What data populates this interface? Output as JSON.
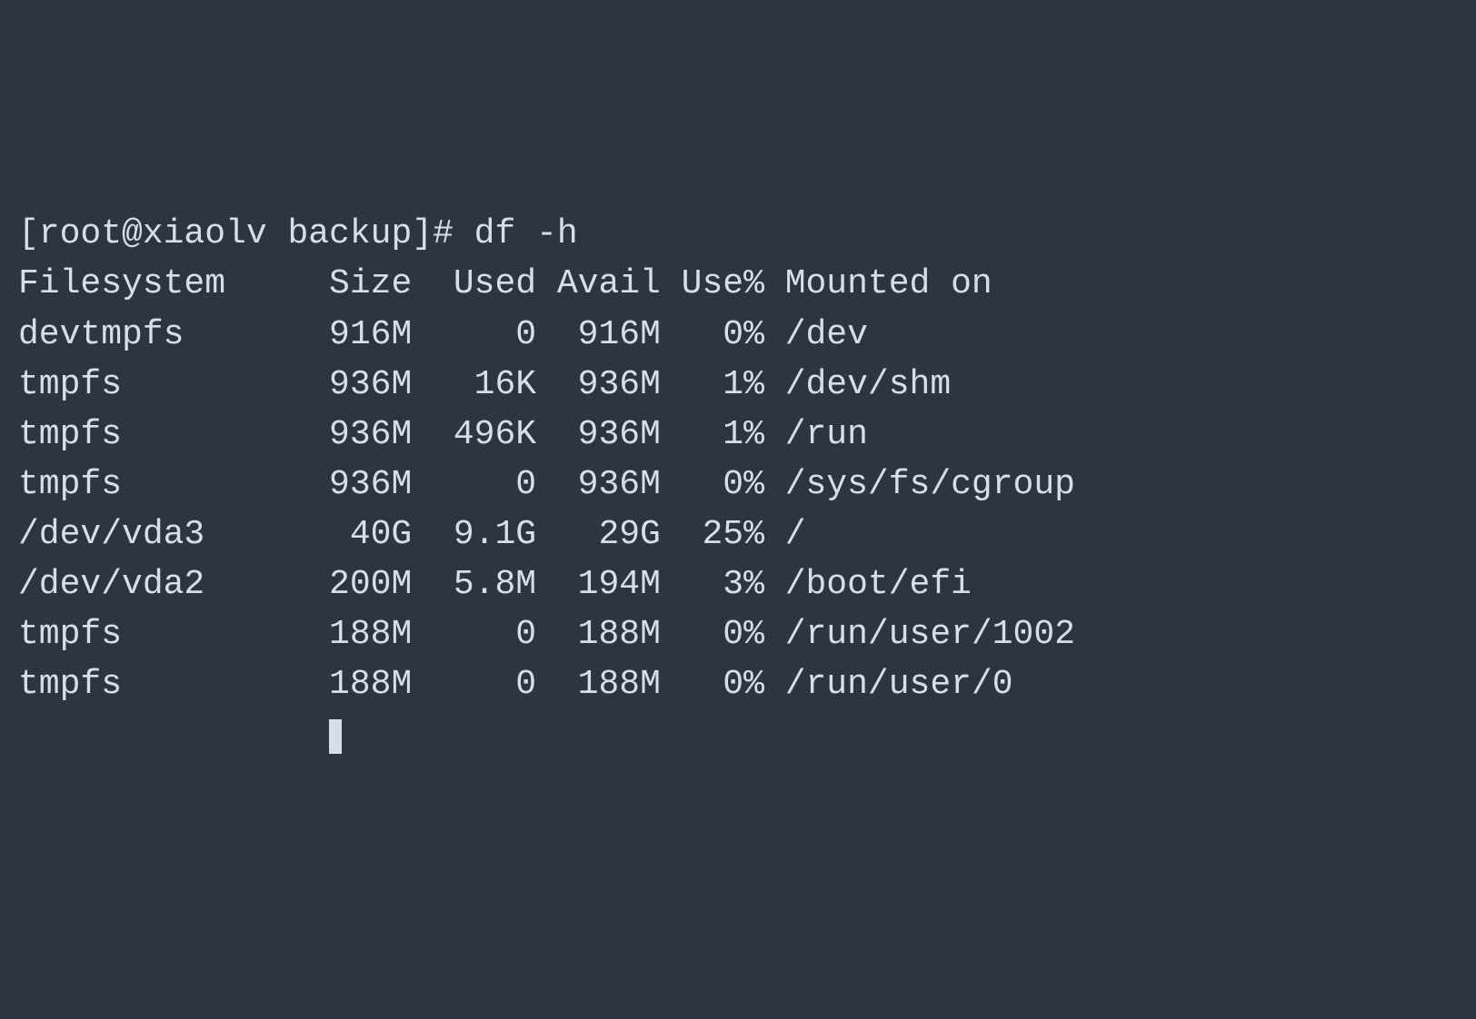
{
  "prompt": "[root@xiaolv backup]# df -h",
  "headers": {
    "filesystem": "Filesystem",
    "size": "Size",
    "used": "Used",
    "avail": "Avail",
    "use_pct": "Use%",
    "mounted": "Mounted on"
  },
  "rows": [
    {
      "filesystem": "devtmpfs",
      "size": "916M",
      "used": "0",
      "avail": "916M",
      "use_pct": "0%",
      "mounted": "/dev"
    },
    {
      "filesystem": "tmpfs",
      "size": "936M",
      "used": "16K",
      "avail": "936M",
      "use_pct": "1%",
      "mounted": "/dev/shm"
    },
    {
      "filesystem": "tmpfs",
      "size": "936M",
      "used": "496K",
      "avail": "936M",
      "use_pct": "1%",
      "mounted": "/run"
    },
    {
      "filesystem": "tmpfs",
      "size": "936M",
      "used": "0",
      "avail": "936M",
      "use_pct": "0%",
      "mounted": "/sys/fs/cgroup"
    },
    {
      "filesystem": "/dev/vda3",
      "size": "40G",
      "used": "9.1G",
      "avail": "29G",
      "use_pct": "25%",
      "mounted": "/"
    },
    {
      "filesystem": "/dev/vda2",
      "size": "200M",
      "used": "5.8M",
      "avail": "194M",
      "use_pct": "3%",
      "mounted": "/boot/efi"
    },
    {
      "filesystem": "tmpfs",
      "size": "188M",
      "used": "0",
      "avail": "188M",
      "use_pct": "0%",
      "mounted": "/run/user/1002"
    },
    {
      "filesystem": "tmpfs",
      "size": "188M",
      "used": "0",
      "avail": "188M",
      "use_pct": "0%",
      "mounted": "/run/user/0"
    }
  ]
}
